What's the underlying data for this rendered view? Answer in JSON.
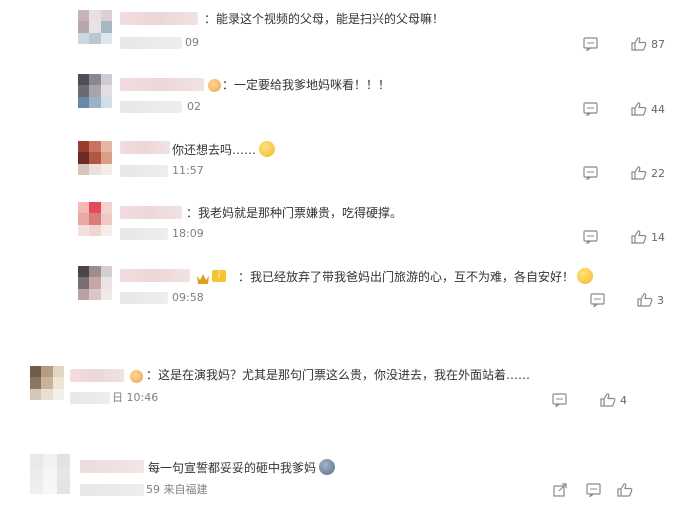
{
  "comments": [
    {
      "text": "：能录这个视频的父母，能是扫兴的父母嘛！",
      "time_visible": "09",
      "like_count": "87",
      "has_badge": false,
      "avatar_colors": [
        "#c9b3b6",
        "#e8dfe0",
        "#d8d0d3",
        "#b4a7ad",
        "#eae3e6",
        "#a7b8c4",
        "#ccd8df",
        "#b8c7d0",
        "#dfe7ea"
      ]
    },
    {
      "text": "：一定要给我爹地妈咪看！！！",
      "time_visible": "02",
      "like_count": "44",
      "has_badge": true,
      "avatar_colors": [
        "#4f4e55",
        "#8a8792",
        "#cfcbd0",
        "#6b6a72",
        "#a8a4ac",
        "#e1dee2",
        "#6a86a8",
        "#9cb1c7",
        "#d3dde8"
      ]
    },
    {
      "text": "你还想去吗……",
      "time_visible": "11:57",
      "like_count": "22",
      "has_badge": false,
      "avatar_colors": [
        "#9d3b2e",
        "#c9735f",
        "#e6b6a4",
        "#6e2b24",
        "#b05842",
        "#d99e87",
        "#d7c6bd",
        "#ece1da",
        "#f3ece7"
      ]
    },
    {
      "text": "：我老妈就是那种门票嫌贵，吃得硬撑。",
      "time_visible": "18:09",
      "like_count": "14",
      "has_badge": false,
      "avatar_colors": [
        "#f2b9b7",
        "#e44a5b",
        "#f5d2cf",
        "#e7a9a0",
        "#d97c7a",
        "#f1c9c4",
        "#f4e1dd",
        "#eed5cf",
        "#f7ece9"
      ]
    },
    {
      "text": "：我已经放弃了带我爸妈出门旅游的心，互不为难，各自安好！",
      "time_visible": "09:58",
      "like_count": "3",
      "has_badge": true,
      "avatar_colors": [
        "#4c4546",
        "#9b8e8f",
        "#d6cfcf",
        "#7a6e6f",
        "#c7a6a6",
        "#ece3e3",
        "#b8a2a3",
        "#d9c7c7",
        "#f0e9e9"
      ]
    },
    {
      "text": "：这是在演我妈？尤其是那句门票这么贵，你没进去，我在外面站着……",
      "time_visible": "日 10:46",
      "like_count": "4",
      "has_badge": true,
      "avatar_colors": [
        "#6f5d4c",
        "#b59d83",
        "#e3d5c3",
        "#8a7560",
        "#c9b39a",
        "#eee4d7",
        "#d5c7b6",
        "#e9e0d5",
        "#f4efe8"
      ]
    },
    {
      "text": "每一句宣誓都妥妥的砸中我爹妈",
      "time_visible": "59 来自福建",
      "like_count": "",
      "has_badge": false,
      "avatar_colors": [
        "#e9e9e9",
        "#f2f2f2",
        "#e2e2e2",
        "#ececec",
        "#f6f6f6",
        "#e6e6e6",
        "#efefef",
        "#f7f7f7",
        "#e4e4e4"
      ]
    }
  ],
  "icons": {
    "comment": "comment-icon",
    "like": "thumbs-up-icon",
    "share": "share-icon"
  },
  "colors": {
    "text": "#333333",
    "meta": "#808080",
    "icon": "#8a8a8a"
  }
}
